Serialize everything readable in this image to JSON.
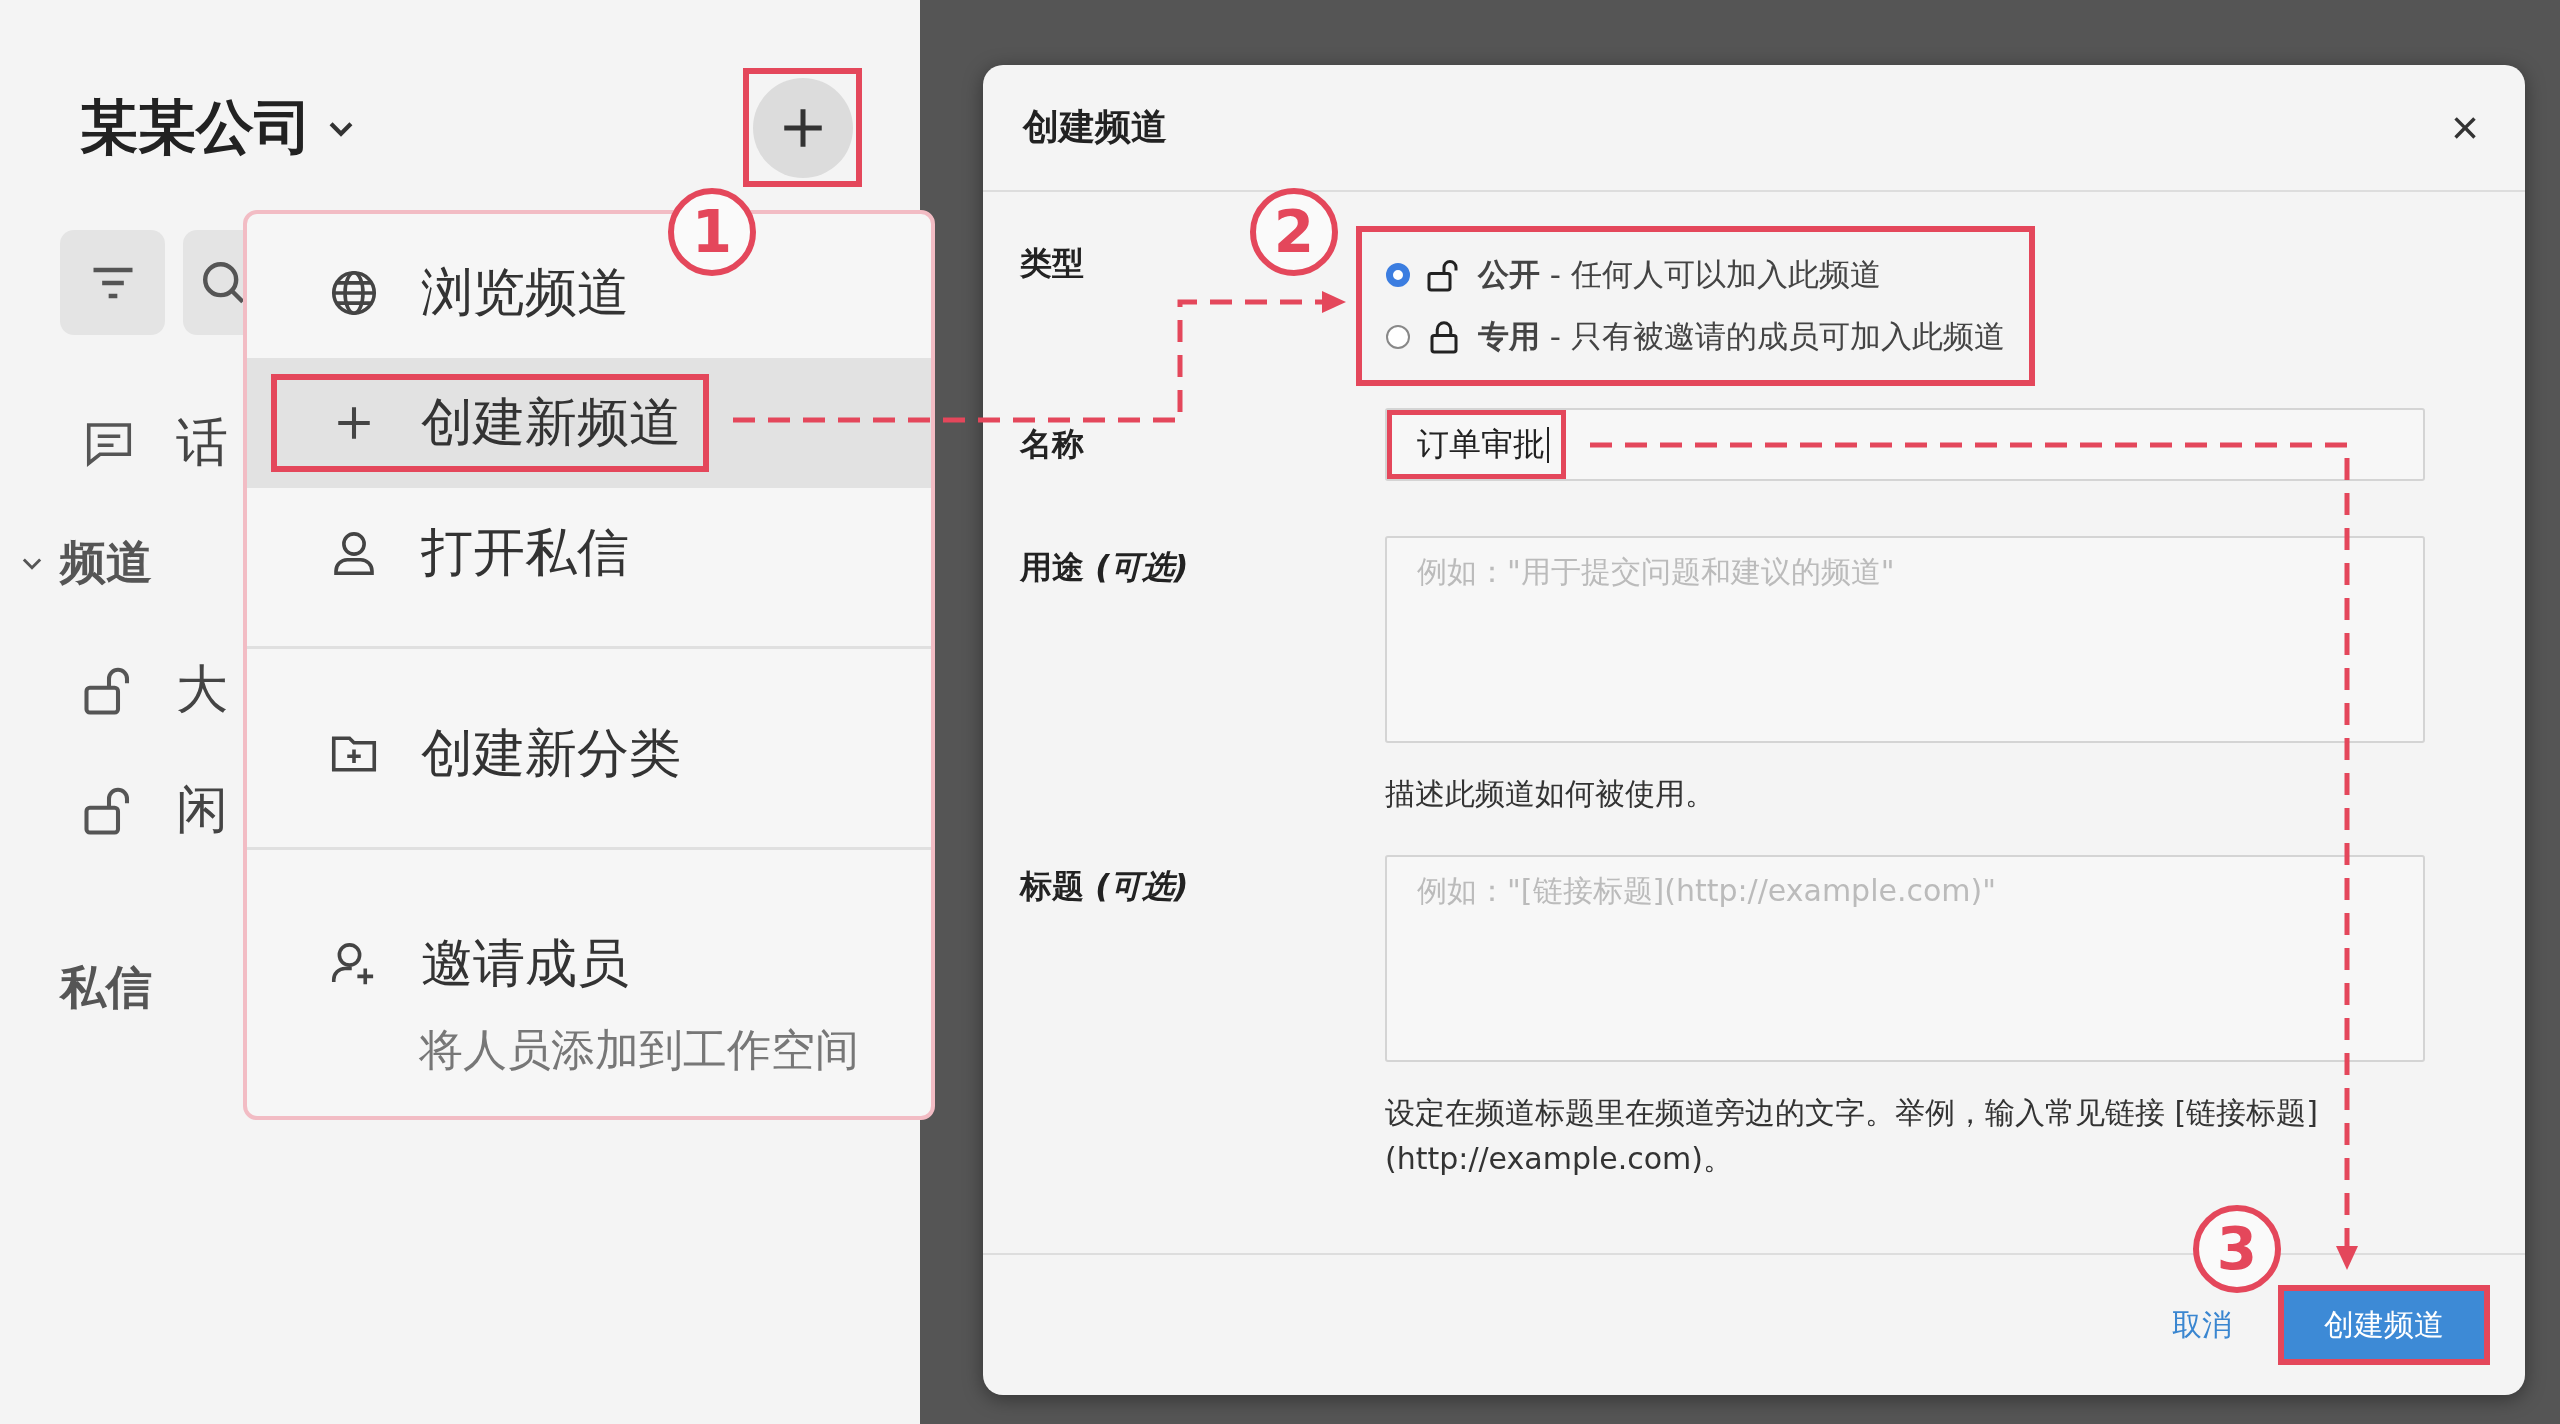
{
  "sidebar": {
    "workspace": "某某公司",
    "add_button": {
      "annotated": true
    },
    "topic": {
      "label": "话"
    },
    "channels_heading": {
      "label": "频道",
      "expanded": true
    },
    "channels": [
      {
        "label": "大"
      },
      {
        "label": "闲"
      }
    ],
    "dm_heading": {
      "label": "私信"
    }
  },
  "menu": {
    "groups": [
      [
        {
          "kind": "browse",
          "label": "浏览频道",
          "selected": false,
          "annotated": false
        },
        {
          "kind": "create",
          "label": "创建新频道",
          "selected": true,
          "annotated": true
        },
        {
          "kind": "message",
          "label": "打开私信",
          "selected": false,
          "annotated": false
        }
      ],
      [
        {
          "kind": "category",
          "label": "创建新分类",
          "selected": false,
          "annotated": false
        }
      ],
      [
        {
          "kind": "invite",
          "label": "邀请成员",
          "description": "将人员添加到工作空间",
          "selected": false,
          "annotated": false
        }
      ]
    ]
  },
  "dialog": {
    "title": "创建频道",
    "close": "×",
    "type": {
      "label": "类型",
      "annotated": true,
      "options": [
        {
          "label": "**公开** - 任何人可以加入此频道",
          "selected": true
        },
        {
          "label": "**专用** - 只有被邀请的成员可加入此频道",
          "selected": false
        }
      ]
    },
    "name": {
      "label": "名称",
      "value": "订单审批",
      "annotated": true
    },
    "purpose": {
      "label": "用途 *(可选)*",
      "placeholder": "例如：\"用于提交问题和建议的频道\"",
      "hint": "描述此频道如何被使用。"
    },
    "header": {
      "label": "标题 *(可选)*",
      "placeholder": "例如：\"[链接标题](http://example.com)\"",
      "hint": "设定在频道标题里在频道旁边的文字。举例，输入常见链接 [链接标题](http://example.com)。"
    },
    "cancel": "取消",
    "submit": {
      "label": "创建频道",
      "annotated": true
    }
  },
  "steps": [
    "1",
    "2",
    "3"
  ]
}
